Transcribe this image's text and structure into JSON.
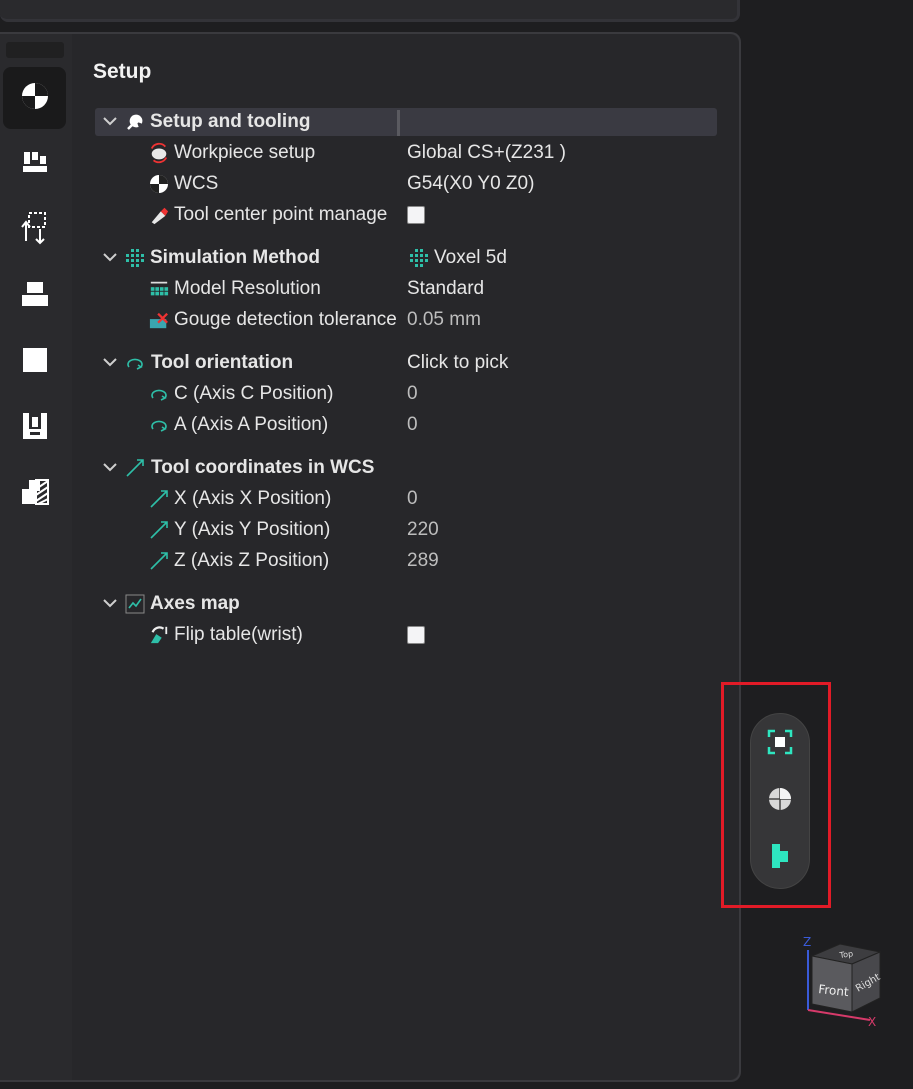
{
  "panel": {
    "title": "Setup"
  },
  "rail": {
    "items": [
      {
        "name": "wcs-icon",
        "active": true
      },
      {
        "name": "tool-holder-icon",
        "active": false
      },
      {
        "name": "transform-icon",
        "active": false
      },
      {
        "name": "stock-icon",
        "active": false
      },
      {
        "name": "part-icon",
        "active": false
      },
      {
        "name": "fixture-icon",
        "active": false
      },
      {
        "name": "material-icon",
        "active": false
      }
    ]
  },
  "tree": {
    "setup_tooling": {
      "label": "Setup and tooling",
      "workpiece_label": "Workpiece setup",
      "workpiece_value": "Global CS+(Z231 )",
      "wcs_label": "WCS",
      "wcs_value": "G54(X0 Y0 Z0)",
      "tcp_label": "Tool center point manage"
    },
    "simulation": {
      "label": "Simulation Method",
      "value": "Voxel 5d",
      "resolution_label": "Model Resolution",
      "resolution_value": "Standard",
      "gouge_label": "Gouge detection tolerance",
      "gouge_value": "0.05 mm"
    },
    "orientation": {
      "label": "Tool orientation",
      "value": "Click to pick",
      "c_label": "C (Axis C Position)",
      "c_value": "0",
      "a_label": "A (Axis A Position)",
      "a_value": "0"
    },
    "coords": {
      "label": "Tool coordinates in WCS",
      "x_label": "X (Axis X Position)",
      "x_value": "0",
      "y_label": "Y (Axis Y Position)",
      "y_value": "220",
      "z_label": "Z (Axis Z Position)",
      "z_value": "289"
    },
    "axes_map": {
      "label": "Axes map",
      "flip_label": "Flip table(wrist)"
    }
  },
  "view_toolbar": {
    "buttons": [
      "fit-view-icon",
      "sphere-view-icon",
      "display-mode-icon"
    ]
  },
  "view_cube": {
    "top": "Top",
    "front": "Front",
    "right": "Right",
    "axis_z": "Z",
    "axis_x": "X"
  },
  "colors": {
    "accent": "#2ee6c0",
    "highlight": "#e21b27"
  }
}
